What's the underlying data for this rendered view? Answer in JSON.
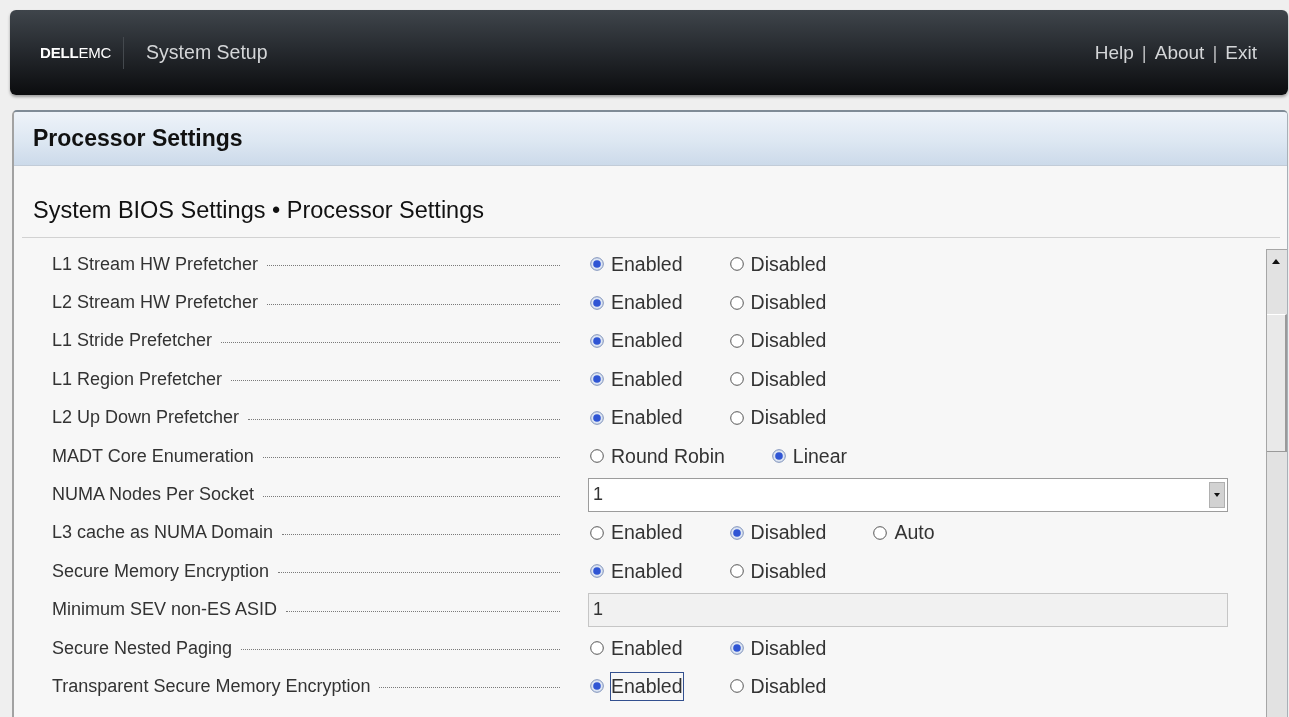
{
  "header": {
    "logo": "**DELL**EMC",
    "title": "System Setup",
    "links": [
      "Help",
      "About",
      "Exit"
    ],
    "link_separator": "|"
  },
  "page_title": "Processor Settings",
  "breadcrumb": "System BIOS Settings • Processor Settings",
  "settings": [
    {
      "label": "L1 Stream HW Prefetcher",
      "kind": "radio",
      "options": [
        {
          "label": "Enabled",
          "selected": true,
          "focused": false
        },
        {
          "label": "Disabled",
          "selected": false,
          "focused": false
        }
      ]
    },
    {
      "label": "L2 Stream HW Prefetcher",
      "kind": "radio",
      "options": [
        {
          "label": "Enabled",
          "selected": true,
          "focused": false
        },
        {
          "label": "Disabled",
          "selected": false,
          "focused": false
        }
      ]
    },
    {
      "label": "L1 Stride Prefetcher",
      "kind": "radio",
      "options": [
        {
          "label": "Enabled",
          "selected": true,
          "focused": false
        },
        {
          "label": "Disabled",
          "selected": false,
          "focused": false
        }
      ]
    },
    {
      "label": "L1 Region Prefetcher",
      "kind": "radio",
      "options": [
        {
          "label": "Enabled",
          "selected": true,
          "focused": false
        },
        {
          "label": "Disabled",
          "selected": false,
          "focused": false
        }
      ]
    },
    {
      "label": "L2 Up Down Prefetcher",
      "kind": "radio",
      "options": [
        {
          "label": "Enabled",
          "selected": true,
          "focused": false
        },
        {
          "label": "Disabled",
          "selected": false,
          "focused": false
        }
      ]
    },
    {
      "label": "MADT Core Enumeration",
      "kind": "radio",
      "options": [
        {
          "label": "Round Robin",
          "selected": false,
          "focused": false
        },
        {
          "label": "Linear",
          "selected": true,
          "focused": false
        }
      ]
    },
    {
      "label": "NUMA Nodes Per Socket",
      "kind": "dropdown",
      "value": "1",
      "disabled": false
    },
    {
      "label": "L3 cache as NUMA Domain",
      "kind": "radio",
      "options": [
        {
          "label": "Enabled",
          "selected": false,
          "focused": false
        },
        {
          "label": "Disabled",
          "selected": true,
          "focused": false
        },
        {
          "label": "Auto",
          "selected": false,
          "focused": false
        }
      ]
    },
    {
      "label": "Secure Memory Encryption",
      "kind": "radio",
      "options": [
        {
          "label": "Enabled",
          "selected": true,
          "focused": false
        },
        {
          "label": "Disabled",
          "selected": false,
          "focused": false
        }
      ]
    },
    {
      "label": "Minimum SEV non-ES ASID",
      "kind": "text",
      "value": "1",
      "disabled": true
    },
    {
      "label": "Secure Nested Paging",
      "kind": "radio",
      "options": [
        {
          "label": "Enabled",
          "selected": false,
          "focused": false
        },
        {
          "label": "Disabled",
          "selected": true,
          "focused": false
        }
      ]
    },
    {
      "label": "Transparent Secure Memory Encryption",
      "kind": "radio",
      "options": [
        {
          "label": "Enabled",
          "selected": true,
          "focused": true
        },
        {
          "label": "Disabled",
          "selected": false,
          "focused": false
        }
      ]
    }
  ]
}
